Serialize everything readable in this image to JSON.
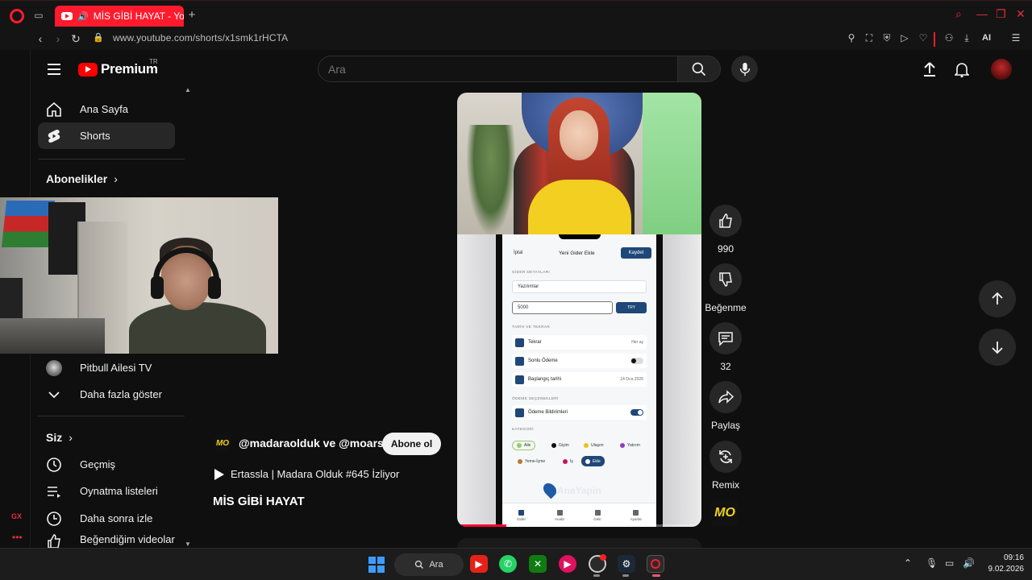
{
  "browser": {
    "tab_title": "MİS GİBİ HAYAT - YouTube",
    "url": "www.youtube.com/shorts/x1smk1rHCTA",
    "ai_label": "AI",
    "gx_label": "GX"
  },
  "header": {
    "logo_word": "Premium",
    "logo_region": "TR",
    "search_placeholder": "Ara"
  },
  "sidebar": {
    "items": [
      {
        "label": "Ana Sayfa"
      },
      {
        "label": "Shorts"
      }
    ],
    "subscriptions_title": "Abonelikler",
    "subscriptions": [
      {
        "label": "Pitbull Ailesi TV"
      },
      {
        "label": "Daha fazla göster"
      }
    ],
    "you_title": "Siz",
    "you_items": [
      {
        "label": "Geçmiş"
      },
      {
        "label": "Oynatma listeleri"
      },
      {
        "label": "Daha sonra izle"
      },
      {
        "label": "Beğendiğim videolar"
      }
    ]
  },
  "short": {
    "channel_text": "@madaraolduk ve @moarsiv",
    "channel_logo": "MO",
    "subscribe_label": "Abone ol",
    "watching_text": "Ertassla | Madara Olduk #645 İzliyor",
    "title": "MİS GİBİ HAYAT",
    "progress": 0.2
  },
  "actions": {
    "like_count": "990",
    "dislike_label": "Beğenme",
    "comment_count": "32",
    "share_label": "Paylaş",
    "remix_label": "Remix",
    "badge": "MO"
  },
  "phone_app": {
    "cancel": "İptal",
    "title": "Yeni Gider Ekle",
    "save": "Kaydet",
    "section_details": "GİDER DETAYLARI",
    "category_value": "Yazılımlar",
    "amount": "5000",
    "currency": "TRY",
    "section_date": "TARİH VE TEKRAR",
    "repeat_label": "Tekrar",
    "repeat_value": "Her ay",
    "limited_label": "Sonlu Ödeme",
    "start_label": "Başlangıç tarihi",
    "start_value": "14 Oca 2026",
    "section_payment": "ÖDEME SEÇENEKLERİ",
    "notify_label": "Ödeme Bildirimleri",
    "section_category": "KATEGORİ",
    "categories": [
      {
        "label": "Aile",
        "color": "#9bc67a"
      },
      {
        "label": "Giyim",
        "color": "#111111"
      },
      {
        "label": "Ulaşım",
        "color": "#e6c619"
      },
      {
        "label": "Yatırım",
        "color": "#8e3fb8"
      },
      {
        "label": "Yeme-İçme",
        "color": "#b5783a"
      },
      {
        "label": "İş",
        "color": "#c2185b"
      },
      {
        "label": "Ekle",
        "color": "#ffffff"
      }
    ],
    "watermark": "AnaYapin",
    "nav": [
      "Gider",
      "Analiz",
      "Gelir",
      "Ayarlar"
    ]
  },
  "taskbar": {
    "search_label": "Ara",
    "time": "09:16",
    "date": "9.02.2026"
  },
  "colors": {
    "accent_red": "#ff0000",
    "opera_red": "#ff1b2d",
    "app_navy": "#1f4778"
  }
}
